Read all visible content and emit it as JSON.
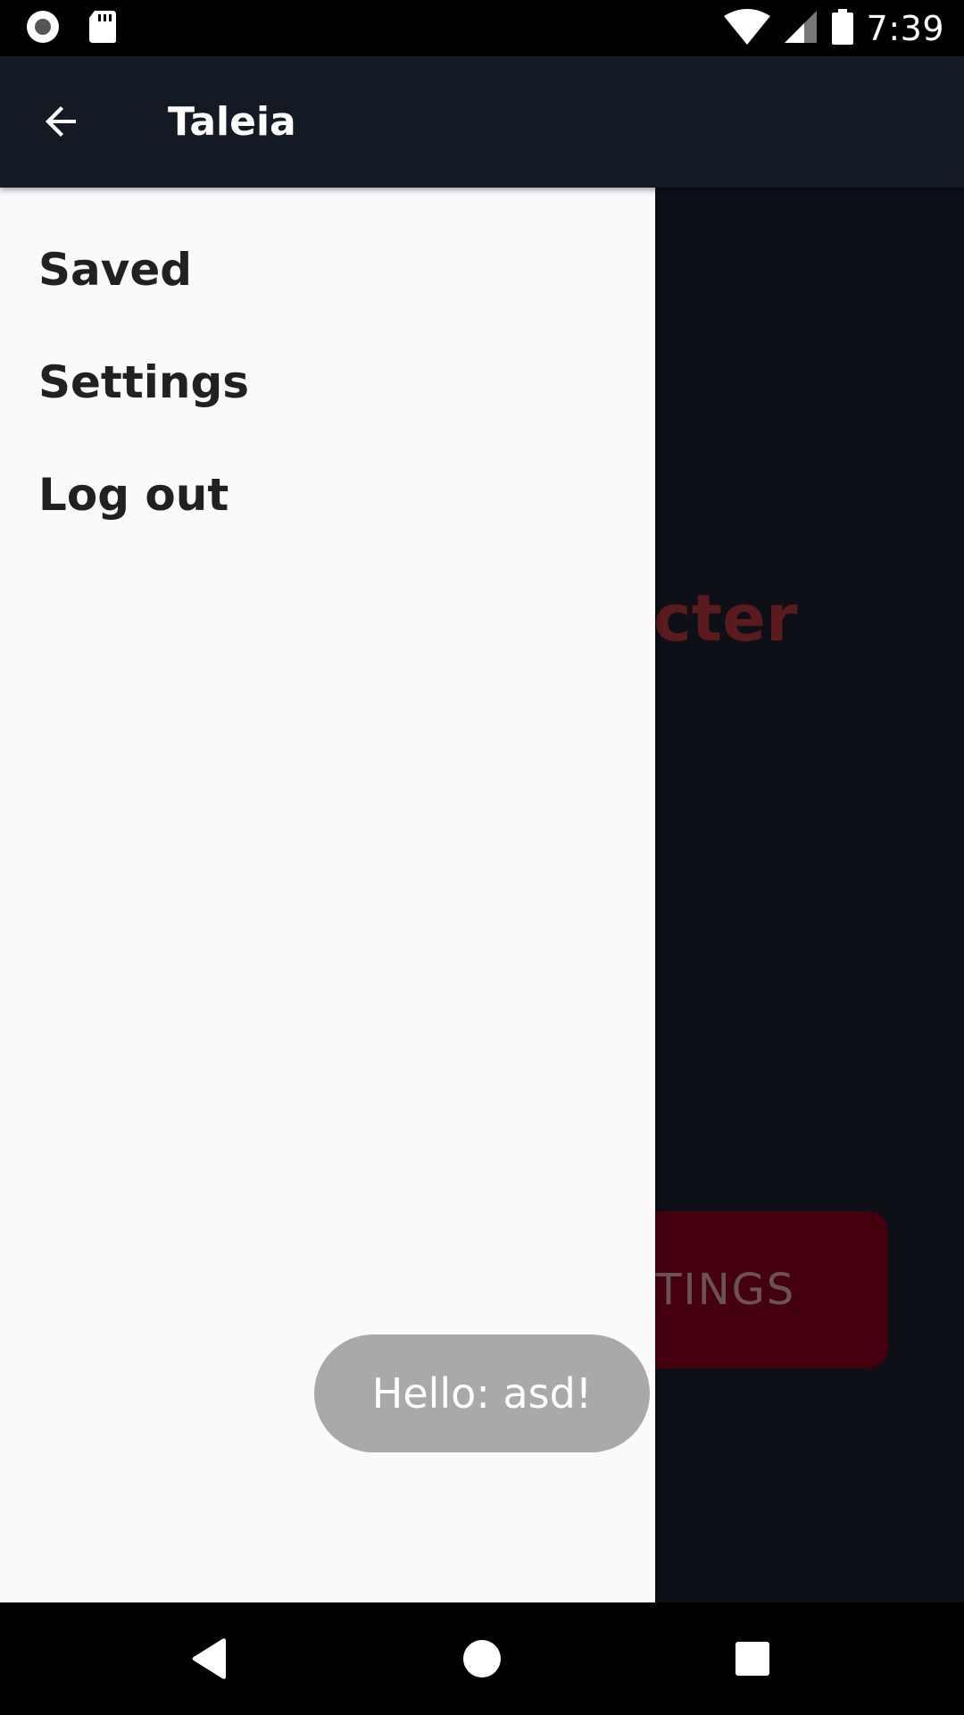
{
  "status_bar": {
    "time": "7:39",
    "icons": [
      "record-icon",
      "sd-card-icon",
      "wifi-icon",
      "cell-signal-icon",
      "battery-icon"
    ]
  },
  "app_bar": {
    "title": "Taleia",
    "back_icon": "arrow-back-icon"
  },
  "drawer": {
    "items": [
      {
        "label": "Saved"
      },
      {
        "label": "Settings"
      },
      {
        "label": "Log out"
      }
    ]
  },
  "background": {
    "heading_partial": "cter",
    "button_label_partial": "TTINGS"
  },
  "toast": {
    "message": "Hello: asd!"
  },
  "nav_bar": {
    "back_icon": "nav-back-icon",
    "home_icon": "nav-home-icon",
    "recents_icon": "nav-recents-icon"
  },
  "colors": {
    "app_bar": "#131a24",
    "background": "#0d1017",
    "drawer": "#fafafa",
    "accent_button": "#45000d",
    "toast": "#a9a9a9"
  }
}
